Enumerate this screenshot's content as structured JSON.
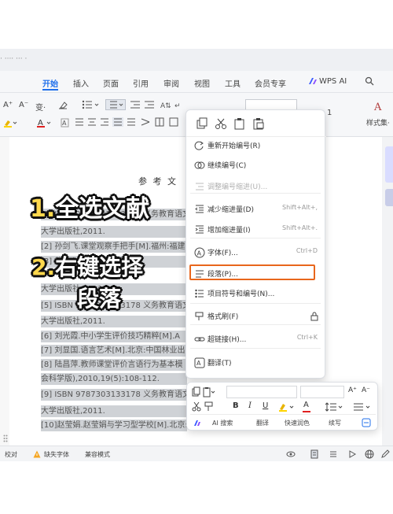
{
  "window": {
    "doc_tab": "· ···· ··· ·"
  },
  "menubar": {
    "items": [
      "开始",
      "插入",
      "页面",
      "引用",
      "审阅",
      "视图",
      "工具",
      "会员专享",
      "WPS AI"
    ],
    "active_index": 0
  },
  "ribbon": {
    "font_size_grow": "A⁺",
    "font_size_shrink": "A⁻",
    "change_case": "变·",
    "line_spacing": "1",
    "styles_label": "样式集·"
  },
  "document": {
    "section_title": "参 考 文",
    "references": [
      {
        "text": "[1] ISBN 9787303133178 义务教育语文课",
        "selected": true
      },
      {
        "text": "大学出版社,2011.",
        "selected": true
      },
      {
        "text": "[2] 孙剑飞.课堂观察手把手[M].福州:福建",
        "selected": true
      },
      {
        "text": "[3] 戴维·迪·吉 高学生研究",
        "selected": true
      },
      {
        "text": "大学出版社,2011.",
        "selected": true
      },
      {
        "text": "[5] ISBN 9787303133178 义务教育语文课",
        "selected": true
      },
      {
        "text": "大学出版社,2011.",
        "selected": true
      },
      {
        "text": "[6] 刘光霞.中小学生评价技巧精粹[M].A",
        "selected": true
      },
      {
        "text": "[7] 刘显国.语言艺术[M].北京:中国林业出",
        "selected": true
      },
      {
        "text": "[8] 陆昌萍.教师课堂评价言语行为基本模",
        "selected": true
      },
      {
        "text": "会科学版),2010,19(5):108-112.",
        "selected": true
      },
      {
        "text": "[9] ISBN 9787303133178 义务教育语文课",
        "selected": true
      },
      {
        "text": "大学出版社,2011.",
        "selected": true
      },
      {
        "text": "[10]赵莹娟.赵莹娟与学习型学校[M].北京:",
        "selected": true
      }
    ]
  },
  "overlays": {
    "step1_num": "1.",
    "step1_text": "全选文献",
    "step2_num": "2.",
    "step2_line1": "右键选择",
    "step2_line2": "段落"
  },
  "context_menu": {
    "items": [
      {
        "label": "重新开始编号(R)",
        "shortcut": "",
        "disabled": false,
        "icon": "restart-numbering-icon"
      },
      {
        "label": "继续编号(C)",
        "shortcut": "",
        "disabled": false,
        "icon": "continue-numbering-icon"
      },
      {
        "label": "调整编号缩进(U)...",
        "shortcut": "",
        "disabled": true,
        "icon": "adjust-indent-icon"
      },
      {
        "label": "减少缩进量(D)",
        "shortcut": "Shift+Alt+,",
        "disabled": false,
        "icon": "decrease-indent-icon"
      },
      {
        "label": "增加缩进量(I)",
        "shortcut": "Shift+Alt+.",
        "disabled": false,
        "icon": "increase-indent-icon"
      },
      {
        "label": "字体(F)...",
        "shortcut": "Ctrl+D",
        "disabled": false,
        "icon": "font-icon"
      },
      {
        "label": "段落(P)...",
        "shortcut": "",
        "disabled": false,
        "icon": "paragraph-icon"
      },
      {
        "label": "项目符号和编号(N)...",
        "shortcut": "",
        "disabled": false,
        "icon": "bullets-numbering-icon"
      },
      {
        "label": "格式刷(F)",
        "shortcut": "",
        "disabled": false,
        "icon": "format-painter-icon"
      },
      {
        "label": "超链接(H)...",
        "shortcut": "Ctrl+K",
        "disabled": false,
        "icon": "hyperlink-icon"
      },
      {
        "label": "翻译(T)",
        "shortcut": "",
        "disabled": false,
        "icon": "translate-icon"
      }
    ],
    "highlight_color": "#e8661c"
  },
  "mini_toolbar": {
    "bold": "B",
    "italic": "I",
    "underline": "U",
    "font_color": "A",
    "ai_search": "AI 搜索",
    "translate": "翻译",
    "quick_polish": "快速润色",
    "continue_write": "续写"
  },
  "statusbar": {
    "proofread": "校对",
    "missing_font": "缺失字体",
    "compat_mode": "兼容模式"
  },
  "colors": {
    "accent": "#1f6feb",
    "selection": "#cfd2d6",
    "overlay_yellow": "#ffd84d"
  }
}
